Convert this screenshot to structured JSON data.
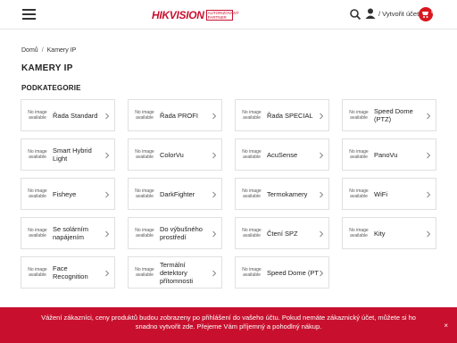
{
  "header": {
    "logo_main": "HIKVISION",
    "logo_sub": "AUTORIZOVANÝ PARTNER",
    "account_label": "/ Vytvořit účet",
    "cart_count": "0"
  },
  "breadcrumb": {
    "home": "Domů",
    "current": "Kamery IP"
  },
  "page_title": "KAMERY IP",
  "section_title": "PODKATEGORIE",
  "no_image_text": "No image available",
  "categories": [
    {
      "label": "Řada Standard"
    },
    {
      "label": "Řada PROFI"
    },
    {
      "label": "Řada SPECIAL"
    },
    {
      "label": "Speed Dome (PTZ)"
    },
    {
      "label": "Smart Hybrid Light"
    },
    {
      "label": "ColorVu"
    },
    {
      "label": "AcuSense"
    },
    {
      "label": "PanoVu"
    },
    {
      "label": "Fisheye"
    },
    {
      "label": "DarkFighter"
    },
    {
      "label": "Termokamery"
    },
    {
      "label": "WiFi"
    },
    {
      "label": "Se solárním napájením"
    },
    {
      "label": "Do výbušného prostředí"
    },
    {
      "label": "Čtení SPZ"
    },
    {
      "label": "Kity"
    },
    {
      "label": "Face Recognition"
    },
    {
      "label": "Termální detektory přítomnosti"
    },
    {
      "label": "Speed Dome (PT"
    }
  ],
  "cookie": {
    "line1": "Vážení zákazníci, ceny produktů budou zobrazeny po přihlášení do vašeho účtu. Pokud nemáte zákaznický účet, můžete si ho",
    "line2": "snadno vytvořit zde. Přejeme Vám příjemný a pohodlný nákup.",
    "close": "×"
  },
  "colors": {
    "brand": "#c8102e",
    "cart": "#d9161f"
  }
}
